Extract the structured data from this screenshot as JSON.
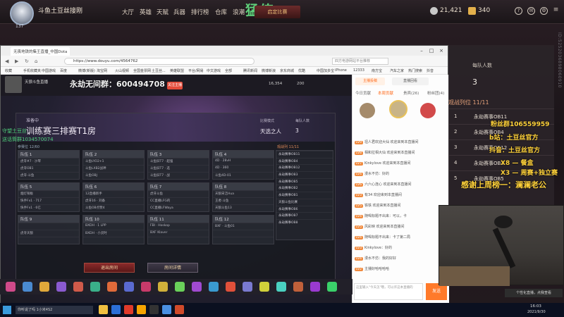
{
  "game": {
    "player_name": "斗鱼土豆丝接刚",
    "level": "137",
    "nav": [
      "大厅",
      "英雄",
      "天赋",
      "兵器",
      "排行榜",
      "仓库",
      "浪潮"
    ],
    "logo_mark": "猛练",
    "start_button": "启定比赛",
    "coins": "21,421",
    "gems": "340"
  },
  "browser": {
    "tab_title": "无畏地铁的集王直播_中国Dota",
    "url": "https://www.douyu.com/4564762",
    "search_hint": "四方电游网站平台推荐",
    "bookmarks": [
      "收藏",
      "手机收藏夹",
      "中国游戏",
      "百度",
      "微博(新版)",
      "淘宝网",
      "火山视频",
      "全国金票网",
      "土豆丝...",
      "英雄联盟",
      "平台/网易",
      "中文游戏",
      "全部",
      "腾讯新闻",
      "微博新浪",
      "京东商城",
      "优酷",
      "中国加多宝",
      "iPhone",
      "12333",
      "南方宝",
      "汽车之家",
      "热门搜索",
      "抖音"
    ]
  },
  "douyu": {
    "room_title": "天狼斗鱼直播",
    "subscribe_label": "关注主播",
    "overlay_title": "永劫无间群：600494708",
    "hot_count": "16,354",
    "sub_count": "200"
  },
  "room_panel": {
    "status": "准备中",
    "name": "训练赛三排赛T1房",
    "mode_label": "比赛模式",
    "mode_value": "天选之人",
    "per_team_label": "每队人数",
    "per_team_value": "3",
    "count_label": "参赛位 12/60",
    "rank_label": "观战列 11/11",
    "teams": [
      {
        "name": "队伍 1",
        "players": [
          "虎牙#7 · 沙琴",
          "虎牙OB1",
          "虎牙·斗鱼"
        ]
      },
      {
        "name": "队伍 2",
        "players": [
          "斗鱼LYO2+1",
          "斗鱼LXB2战神",
          "斗鱼OBJ"
        ]
      },
      {
        "name": "队伍 3",
        "players": [
          "斗鱼旧T7 · 超强",
          "斗鱼旧T7 · 选",
          "斗鱼旧T7 · 战"
        ]
      },
      {
        "name": "队伍 4",
        "players": [
          "4D · 28vH",
          "4D · 360",
          "斗鱼4D-01"
        ]
      },
      {
        "name": "队伍 5",
        "players": [
          "烟灯铜板",
          "快手Fx1 · 717",
          "快手Fx1 · 6亿"
        ]
      },
      {
        "name": "队伍 6",
        "players": [
          "12直播新手",
          "虎牙16 · 刘备",
          "斗鱼OB点赞4"
        ]
      },
      {
        "name": "队伍 7",
        "players": [
          "虎牙斗鱼",
          "CC直播LFG的",
          "CC直播LFWaya"
        ]
      },
      {
        "name": "队伍 8",
        "players": [
          "天狼宋洁Hua",
          "王者·斗鱼",
          "天狼斗鱼13"
        ]
      },
      {
        "name": "队伍 9",
        "players": [
          "",
          "虎牙天狼",
          ""
        ]
      },
      {
        "name": "队伍 10",
        "players": [
          "BXDH · 1 LPP",
          "BXDH · 小灵时",
          ""
        ]
      },
      {
        "name": "队伍 11",
        "players": [
          "FBI · Hoskop",
          "BXF Klaver",
          ""
        ]
      },
      {
        "name": "队伍 12",
        "players": [
          "BXF · 斗鱼01",
          "",
          ""
        ]
      }
    ],
    "rank_list": [
      "永劫赛事OB11",
      "永劫赛事OB4",
      "永劫赛事OB12",
      "永劫赛事OB3",
      "永劫赛事OB5",
      "永劫赛事OB2",
      "永劫赛事OB1",
      "天狼斗鱼比赛",
      "永劫赛事OB6",
      "永劫赛事OB7",
      "永劫赛事OB8"
    ],
    "exit_button": "退出房间",
    "detail_button": "房间详情"
  },
  "chat": {
    "tabs": [
      "今日贡献",
      "本周贡献",
      "贵宾(26)",
      "粉丝团(4)"
    ],
    "lines": [
      {
        "badge": "LV9",
        "text": "坦人君欢迎大仙 欢迎来到本直播间"
      },
      {
        "badge": "LV8",
        "text": "相和拉相大仙 欢迎来到本直播间"
      },
      {
        "badge": "LV7",
        "text": "Kinkylove 欢迎来到本直播间"
      },
      {
        "badge": "LV4",
        "text": "漫水不仿：好的"
      },
      {
        "badge": "LV6",
        "text": "六六心连心 欢迎来到本直播间"
      },
      {
        "badge": "LV3",
        "text": "有34 欢迎来到本直播间"
      },
      {
        "badge": "LV5",
        "text": "铁铁 欢迎来到本直播间"
      },
      {
        "badge": "LV4",
        "text": "随喝标题不出来：可以，卡"
      },
      {
        "badge": "LV5",
        "text": "风彩映 欢迎来到本直播间"
      },
      {
        "badge": "LV4",
        "text": "随喝标题不出来：卡了第二局"
      },
      {
        "badge": "LV3",
        "text": "Kinkylove：好的"
      },
      {
        "badge": "LV4",
        "text": "漫水不仿：我的好好"
      },
      {
        "badge": "LV2",
        "text": "主播好哈哈哈哈"
      }
    ],
    "input_placeholder": "这里输入\"今天怎\"哦，可以许这本直播的",
    "send_button": "发送"
  },
  "side_panel": {
    "per_team_label": "每队人数",
    "per_team_value": "3",
    "rank_label": "观战列位 11/11",
    "rank_list": [
      "永劫赛事OB11",
      "永劫赛事OB4",
      "永劫赛事OB12",
      "永劫赛事OB3",
      "永劫赛事OB5"
    ]
  },
  "overlays": {
    "fan_group": "粉丝群106559959",
    "bilibili": "b站：土豆丝官方",
    "douyin": "抖音：土豆丝官方",
    "x8": "X8 — 餐盒",
    "x3": "X3 — 周赛+独立赛",
    "thanks": "感谢上周榜一：澜澜老公",
    "left_hint_1": "守望土豆丝",
    "left_hint_2": "送话筒群1034570074"
  },
  "taskbar": {
    "search_text": "你听说了吗 1小米4S2",
    "toast": "个性化直播，点我查看",
    "time": "16:03",
    "date": "2021/9/30"
  }
}
